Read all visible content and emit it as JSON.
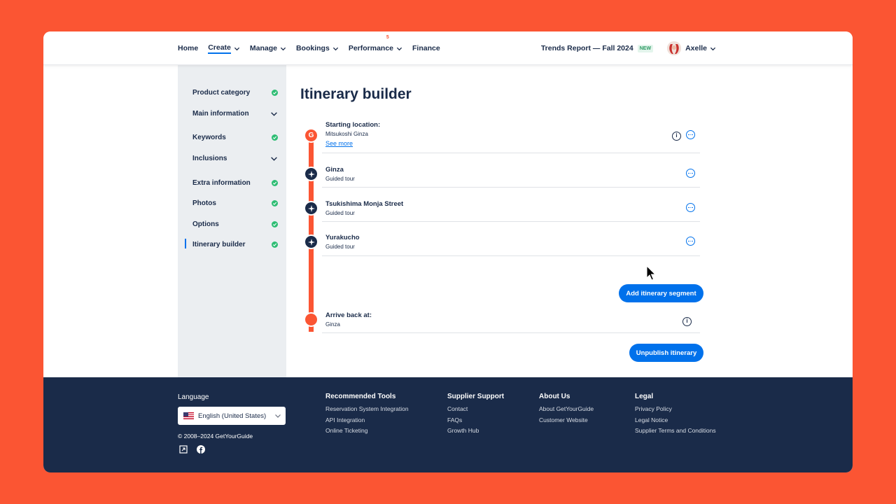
{
  "header": {
    "nav": [
      {
        "label": "Home",
        "dropdown": false
      },
      {
        "label": "Create",
        "dropdown": true,
        "active": true
      },
      {
        "label": "Manage",
        "dropdown": true
      },
      {
        "label": "Bookings",
        "dropdown": true
      },
      {
        "label": "Performance",
        "dropdown": true,
        "badge": "5"
      },
      {
        "label": "Finance",
        "dropdown": false
      }
    ],
    "trends_link": "Trends Report — Fall 2024",
    "new_badge": "NEW",
    "user_name": "Axelle"
  },
  "sidebar": {
    "items": [
      {
        "label": "Product category",
        "status": "check"
      },
      {
        "label": "Main information",
        "status": "chevron"
      },
      {
        "label": "Keywords",
        "status": "check"
      },
      {
        "label": "Inclusions",
        "status": "chevron"
      },
      {
        "label": "Extra information",
        "status": "check"
      },
      {
        "label": "Photos",
        "status": "check"
      },
      {
        "label": "Options",
        "status": "check"
      },
      {
        "label": "Itinerary builder",
        "status": "check",
        "active": true
      }
    ]
  },
  "main": {
    "title": "Itinerary builder",
    "start": {
      "title": "Starting location:",
      "subtitle": "Mitsukoshi Ginza",
      "link": "See more",
      "node_letter": "G"
    },
    "segments": [
      {
        "title": "Ginza",
        "subtitle": "Guided tour"
      },
      {
        "title": "Tsukishima Monja Street",
        "subtitle": "Guided tour"
      },
      {
        "title": "Yurakucho",
        "subtitle": "Guided tour"
      }
    ],
    "add_button": "Add itinerary segment",
    "end": {
      "title": "Arrive back at:",
      "subtitle": "Ginza"
    },
    "unpublish_button": "Unpublish itinerary",
    "info_glyph": "i"
  },
  "footer": {
    "language_heading": "Language",
    "language_value": "English (United States)",
    "copyright": "© 2008–2024 GetYourGuide",
    "columns": [
      {
        "heading": "Recommended Tools",
        "links": [
          "Reservation System Integration",
          "API Integration",
          "Online Ticketing"
        ]
      },
      {
        "heading": "Supplier Support",
        "links": [
          "Contact",
          "FAQs",
          "Growth Hub"
        ]
      },
      {
        "heading": "About Us",
        "links": [
          "About GetYourGuide",
          "Customer Website"
        ]
      },
      {
        "heading": "Legal",
        "links": [
          "Privacy Policy",
          "Legal Notice",
          "Supplier Terms and Conditions"
        ]
      }
    ],
    "social_icons": [
      "external-link-icon",
      "facebook-icon"
    ]
  },
  "colors": {
    "background": "#fb5533",
    "brand_dark": "#1a2b49",
    "primary_blue": "#0071eb",
    "accent_orange": "#fb5533",
    "success_green": "#2ebd74",
    "sidebar_bg": "#ebeef1"
  }
}
